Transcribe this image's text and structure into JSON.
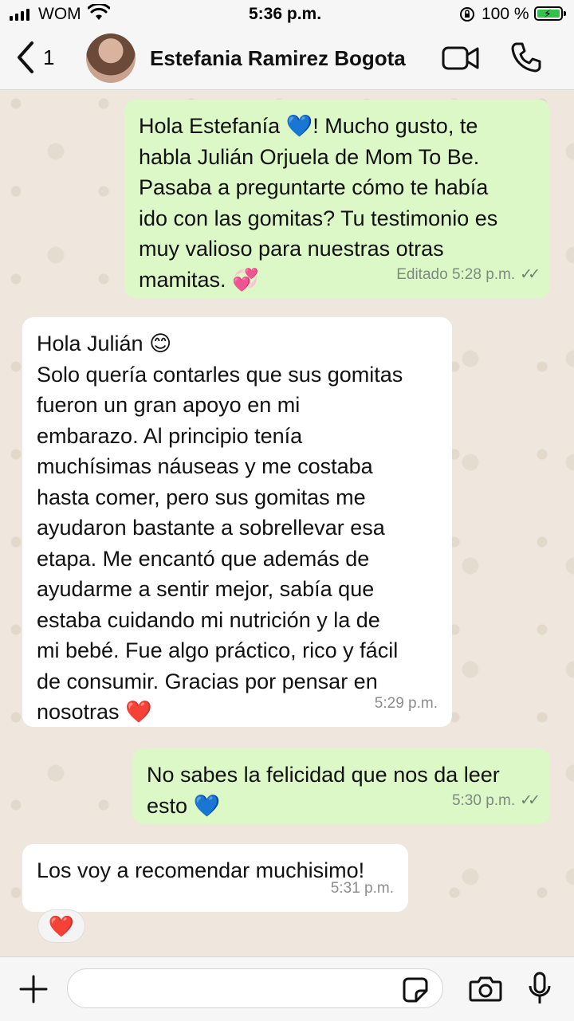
{
  "status_bar": {
    "carrier": "WOM",
    "time": "5:36 p.m.",
    "battery": "100 %"
  },
  "header": {
    "back_count": "1",
    "contact_name": "Estefania Ramirez Bogota"
  },
  "messages": [
    {
      "direction": "outgoing",
      "text": "Hola Estefanía 💙! Mucho gusto, te\nhabla Julián Orjuela de Mom To Be.\nPasaba a preguntarte cómo te había\nido con las gomitas? Tu testimonio es\nmuy valioso para nuestras otras\nmamitas. 💞",
      "meta": "Editado 5:28 p.m."
    },
    {
      "direction": "incoming",
      "text": "Hola Julián 😊\nSolo quería contarles que sus gomitas\nfueron un gran apoyo en mi\nembarazo. Al principio tenía\nmuchísimas náuseas y me costaba\nhasta comer, pero sus gomitas me\nayudaron bastante a sobrellevar esa\netapa. Me encantó que además de\nayudarme a sentir mejor, sabía que\nestaba cuidando mi nutrición y la de\nmi bebé. Fue algo práctico, rico y fácil\nde consumir. Gracias por pensar en\nnosotras ❤️",
      "meta": "5:29 p.m."
    },
    {
      "direction": "outgoing",
      "text": "No sabes la felicidad que nos da leer\nesto 💙",
      "meta": "5:30 p.m."
    },
    {
      "direction": "incoming",
      "text": "Los voy a recomendar muchisimo!",
      "meta": "5:31 p.m."
    }
  ],
  "reaction": "❤️",
  "colors": {
    "outgoing_bubble": "#dcf8c6",
    "incoming_bubble": "#ffffff",
    "wallpaper": "#efe7de",
    "accent": "#007aff"
  },
  "icons": [
    "signal-icon",
    "wifi-icon",
    "rotation-lock-icon",
    "battery-icon",
    "back-chevron-icon",
    "video-call-icon",
    "phone-icon",
    "plus-icon",
    "sticker-icon",
    "camera-icon",
    "microphone-icon",
    "read-ticks-icon"
  ]
}
